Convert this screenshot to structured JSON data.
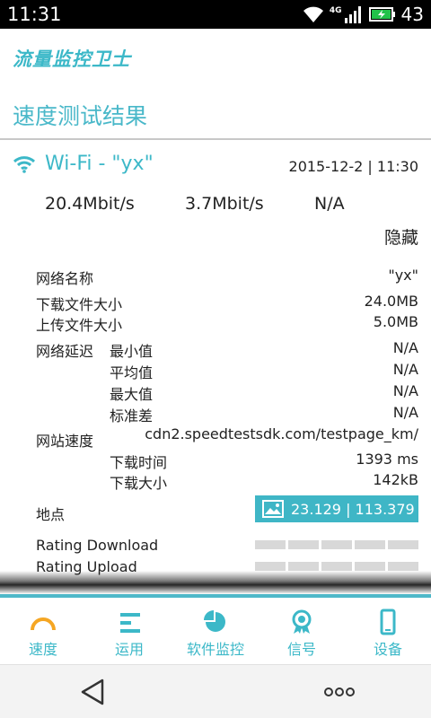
{
  "statusbar": {
    "time": "11:31",
    "network": "4G",
    "battery_level": "43"
  },
  "app": {
    "logo": "流量监控卫士",
    "section_title": "速度测试结果"
  },
  "result": {
    "network_label": "Wi-Fi - \"yx\"",
    "datetime": "2015-12-2 | 11:30",
    "download_speed": "20.4Mbit/s",
    "upload_speed": "3.7Mbit/s",
    "ping": "N/A",
    "hide_label": "隐藏"
  },
  "details": {
    "network_name_label": "网络名称",
    "network_name_value": "\"yx\"",
    "download_size_label": "下载文件大小",
    "download_size_value": "24.0MB",
    "upload_size_label": "上传文件大小",
    "upload_size_value": "5.0MB",
    "latency_label": "网络延迟",
    "latency_min_label": "最小值",
    "latency_min_value": "N/A",
    "latency_avg_label": "平均值",
    "latency_avg_value": "N/A",
    "latency_max_label": "最大值",
    "latency_max_value": "N/A",
    "latency_std_label": "标准差",
    "latency_std_value": "N/A",
    "site_speed_label": "网站速度",
    "site_url": "cdn2.speedtestsdk.com/testpage_km/",
    "download_time_label": "下载时间",
    "download_time_value": "1393 ms",
    "download_amount_label": "下载大小",
    "download_amount_value": "142kB",
    "location_label": "地点",
    "location_value": "23.129 | 113.379",
    "rating_download_label": "Rating Download",
    "rating_upload_label": "Rating Upload"
  },
  "bottom_nav": {
    "speed": "速度",
    "usage": "运用",
    "software_monitor": "软件监控",
    "signal": "信号",
    "device": "设备"
  },
  "colors": {
    "accent": "#3cb8c8",
    "location_button": "#3fb6c6",
    "rating_empty": "#d8d8d8"
  },
  "icons": {
    "wifi": "wifi-icon",
    "map": "map-icon",
    "speed": "gauge-icon",
    "usage": "bars-icon",
    "software_monitor": "pie-icon",
    "signal": "badge-icon",
    "device": "phone-icon",
    "back": "back-triangle-icon",
    "more": "more-dots-icon"
  }
}
